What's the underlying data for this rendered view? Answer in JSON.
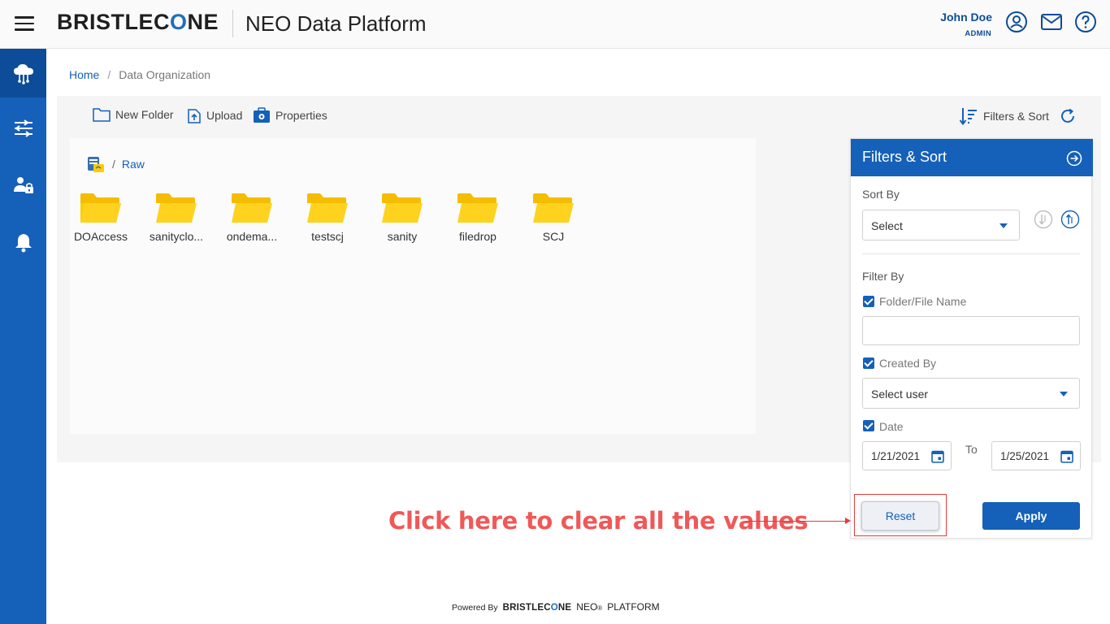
{
  "header": {
    "brand_prefix": "BRISTLEC",
    "brand_o": "O",
    "brand_suffix": "NE",
    "platform_title": "NEO Data Platform",
    "user_name": "John Doe",
    "user_role": "ADMIN"
  },
  "sidebar": {
    "items": [
      {
        "icon": "cloud-network-icon",
        "active": true
      },
      {
        "icon": "pipeline-icon",
        "active": false
      },
      {
        "icon": "user-admin-icon",
        "active": false
      },
      {
        "icon": "bell-icon",
        "active": false
      }
    ]
  },
  "breadcrumb": {
    "home": "Home",
    "separator": "/",
    "current": "Data Organization"
  },
  "toolbar": {
    "new_folder": "New Folder",
    "upload": "Upload",
    "properties": "Properties",
    "filters_sort": "Filters & Sort"
  },
  "path": {
    "separator": "/",
    "current": "Raw"
  },
  "folders": [
    {
      "label": "DOAccess"
    },
    {
      "label": "sanityclo..."
    },
    {
      "label": "ondema..."
    },
    {
      "label": "testscj"
    },
    {
      "label": "sanity"
    },
    {
      "label": "filedrop"
    },
    {
      "label": "SCJ"
    }
  ],
  "filters_panel": {
    "title": "Filters & Sort",
    "sort_by_label": "Sort By",
    "sort_select_value": "Select",
    "filter_by_label": "Filter By",
    "name_filter_label": "Folder/File Name",
    "name_filter_value": "",
    "created_by_label": "Created By",
    "created_by_value": "Select user",
    "date_label": "Date",
    "date_from": "1/21/2021",
    "to_label": "To",
    "date_to": "1/25/2021",
    "reset_label": "Reset",
    "apply_label": "Apply"
  },
  "annotation": {
    "text": "Click here to clear all the values"
  },
  "footer": {
    "powered_by": "Powered By",
    "brand_prefix": "BRISTLEC",
    "brand_o": "O",
    "brand_suffix": "NE",
    "neo": "NEO",
    "reg": "®",
    "platform": "PLATFORM"
  },
  "colors": {
    "primary": "#1560b8",
    "primary_dark": "#0d4c98",
    "folder": "#ffcc00",
    "annotation": "#f05858"
  }
}
